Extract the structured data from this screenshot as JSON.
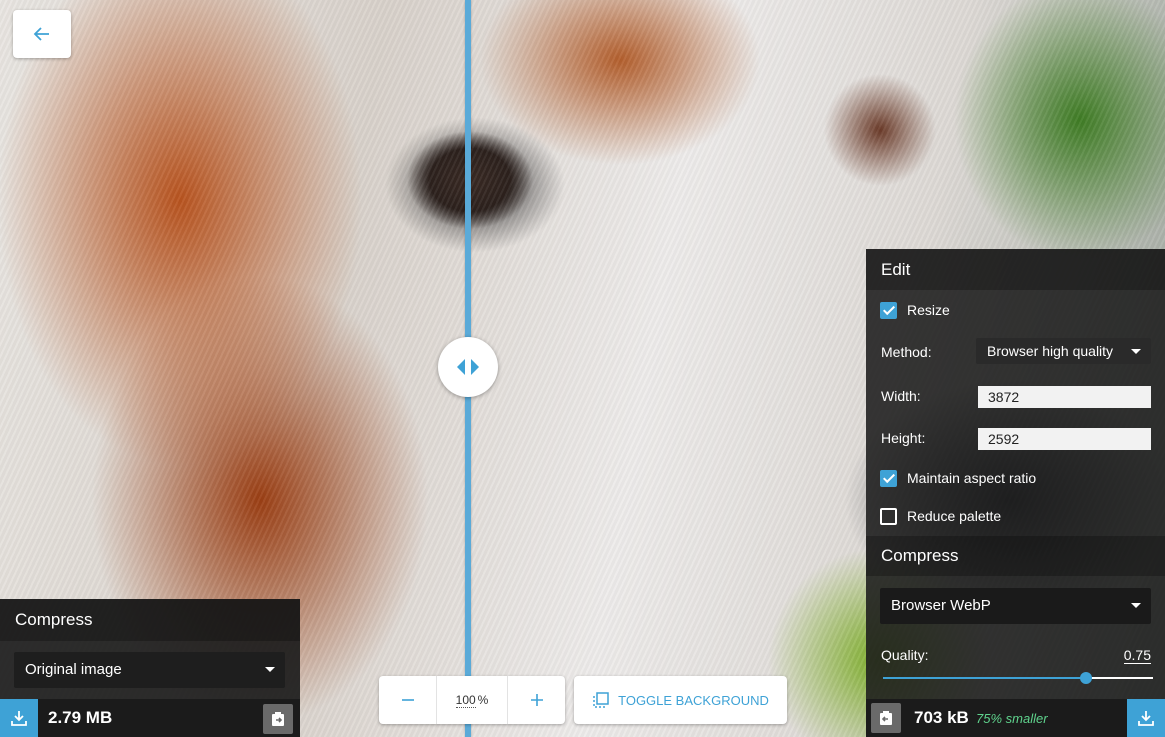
{
  "nav": {
    "back_icon": "arrow-left-icon"
  },
  "zoom": {
    "value": "100",
    "unit": "%",
    "zoom_out_icon": "minus-icon",
    "zoom_in_icon": "plus-icon"
  },
  "toggle_background": {
    "label": "TOGGLE BACKGROUND",
    "icon": "background-toggle-icon"
  },
  "left_panel": {
    "title": "Compress",
    "method": "Original image",
    "size": "2.79 MB"
  },
  "right_panel": {
    "edit_title": "Edit",
    "resize_label": "Resize",
    "resize_checked": true,
    "method_label": "Method:",
    "method_value": "Browser high quality",
    "width_label": "Width:",
    "width_value": "3872",
    "height_label": "Height:",
    "height_value": "2592",
    "aspect_label": "Maintain aspect ratio",
    "aspect_checked": true,
    "palette_label": "Reduce palette",
    "palette_checked": false,
    "compress_title": "Compress",
    "encoder_value": "Browser WebP",
    "quality_label": "Quality:",
    "quality_value": "0.75",
    "quality_fraction": 0.75,
    "size": "703 kB",
    "savings": "75% smaller"
  },
  "colors": {
    "accent": "#3ea2d6",
    "savings": "#5fd38d",
    "panel": "#1c1c1c"
  }
}
